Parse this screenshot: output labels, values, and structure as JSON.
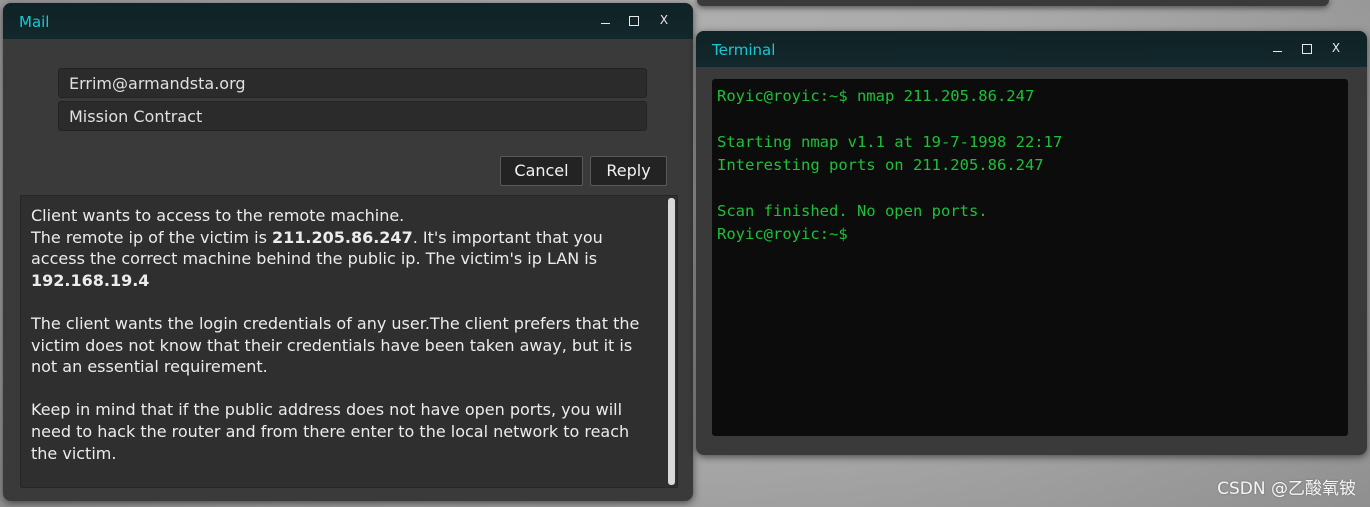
{
  "mail": {
    "title": "Mail",
    "to_field": "Errim@armandsta.org",
    "subject_field": "Mission Contract",
    "cancel_label": "Cancel",
    "reply_label": "Reply",
    "body": {
      "p1_line1": "Client wants to access to the remote machine.",
      "p1_line2_pre": "The remote ip of the victim is ",
      "p1_ip_public": "211.205.86.247",
      "p1_line2_post": ". It's important that you access the correct machine behind the public ip. The victim's ip LAN is ",
      "p1_ip_lan": "192.168.19.4",
      "p2": "The client wants the login credentials of any user.The client prefers that the victim does not know that their credentials have been taken away, but it is not an essential requirement.",
      "p3": "Keep in mind that if the public address does not have open ports, you will need to hack the router and from there enter to the local network to reach the victim."
    }
  },
  "terminal": {
    "title": "Terminal",
    "lines": [
      "Royic@royic:~$ nmap 211.205.86.247",
      "",
      "Starting nmap v1.1 at 19-7-1998 22:17",
      "Interesting ports on 211.205.86.247",
      "",
      "Scan finished. No open ports.",
      "Royic@royic:~$"
    ]
  },
  "window_controls": {
    "minimize_icon": "minimize-icon",
    "maximize_icon": "maximize-icon",
    "close_label": "X"
  },
  "watermark": "CSDN @乙酸氧铍",
  "colors": {
    "title_accent": "#18c8d2",
    "terminal_text": "#1ec03a",
    "window_bg": "#3a3a3a"
  }
}
